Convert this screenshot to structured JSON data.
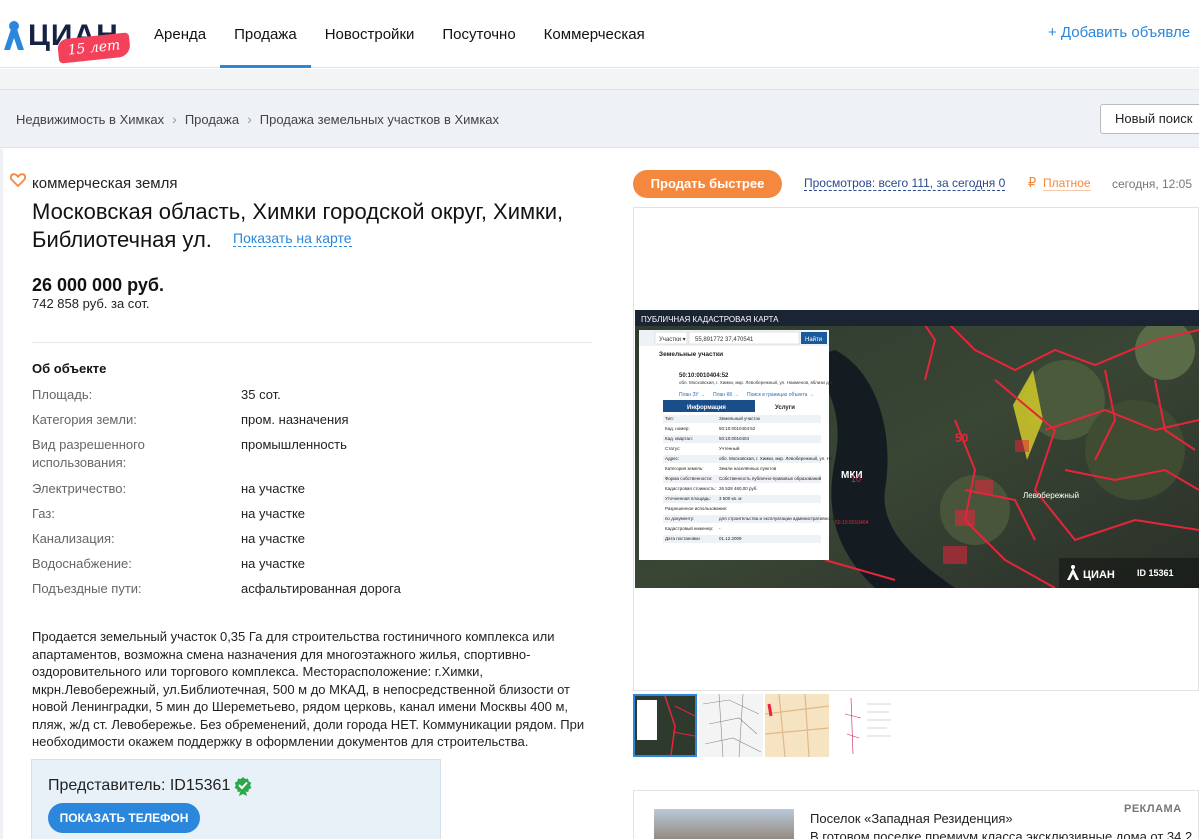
{
  "header": {
    "logo_text": "ЦИАН",
    "logo_badge": "15 лет",
    "nav": [
      {
        "label": "Аренда",
        "active": false
      },
      {
        "label": "Продажа",
        "active": true
      },
      {
        "label": "Новостройки",
        "active": false
      },
      {
        "label": "Посуточно",
        "active": false
      },
      {
        "label": "Коммерческая",
        "active": false
      }
    ],
    "add_ad": "+ Добавить объявле"
  },
  "breadcrumbs": {
    "items": [
      "Недвижимость в Химках",
      "Продажа",
      "Продажа земельных участков в Химках"
    ],
    "new_search": "Новый поиск"
  },
  "listing": {
    "category": "коммерческая земля",
    "address": "Московская область, Химки городской округ, Химки, Библиотечная ул.",
    "map_link": "Показать на карте",
    "price": "26 000 000 руб.",
    "price_per": "742 858 руб. за сот.",
    "about_title": "Об объекте",
    "props": [
      {
        "k": "Площадь:",
        "v": "35 сот."
      },
      {
        "k": "Категория земли:",
        "v": "пром. назначения"
      },
      {
        "k": "Вид разрешенного использования:",
        "v": "промышленность"
      },
      {
        "k": "Электричество:",
        "v": "на участке"
      },
      {
        "k": "Газ:",
        "v": "на участке"
      },
      {
        "k": "Канализация:",
        "v": "на участке"
      },
      {
        "k": "Водоснабжение:",
        "v": "на участке"
      },
      {
        "k": "Подъездные пути:",
        "v": "асфальтированная дорога"
      }
    ],
    "description": "Продается земельный участок 0,35 Га для строительства гостиничного комплекса или апартаментов, возможна смена назначения для многоэтажного жилья, спортивно-оздоровительного или торгового комплекса. Месторасположение: г.Химки, мкрн.Левобережный, ул.Библиотечная, 500 м до МКАД, в непосредственной близости от новой Ленинградки, 5 мин до Шереметьево, рядом церковь, канал имени Москвы 400 м, пляж, ж/д ст. Левобережье. Без обременений, доли города НЕТ. Коммуникации рядом. При необходимости окажем поддержку в оформлении документов для строительства.",
    "agent": "Представитель: ID15361",
    "phone_button": "ПОКАЗАТЬ ТЕЛЕФОН"
  },
  "sidebar": {
    "sell_button": "Продать быстрее",
    "views": "Просмотров: всего 111, за сегодня 0",
    "paid_icon": "₽",
    "paid": "Платное",
    "time": "сегодня, 12:05",
    "photo": {
      "map_title": "ПУБЛИЧНАЯ КАДАСТРОВАЯ КАРТА",
      "search_select": "Участки ▾",
      "search_value": "55,891772 37,470541",
      "search_button": "Найти",
      "panel_title": "Земельные участки",
      "parcel_no": "50:10:0010404:52",
      "parcel_addr": "обл. Московская, г. Химки, мкр. Левобережный, ул. Наименов, вблизи д.2",
      "links": [
        "План ЗУ →",
        "План КК →",
        "Поиск в границах объекта →"
      ],
      "tabs": [
        "Информация",
        "Услуги"
      ],
      "rows": [
        {
          "k": "Тип:",
          "v": "Земельный участок"
        },
        {
          "k": "Кад. номер:",
          "v": "50:10:0010404:52"
        },
        {
          "k": "Кад. квартал:",
          "v": "50:10:0010404"
        },
        {
          "k": "Статус:",
          "v": "Учтенный"
        },
        {
          "k": "Адрес:",
          "v": "обл. Московская, г. Химки, мкр. Левобережный, ул. Наименов, вблизи д.2"
        },
        {
          "k": "Категория земель:",
          "v": "Земли населённых пунктов"
        },
        {
          "k": "Форма собственности:",
          "v": "Собственность публично-правовых образований"
        },
        {
          "k": "Кадастровая стоимость:",
          "v": "26 528 460,00 руб."
        },
        {
          "k": "Уточненная площадь:",
          "v": "3 500 кв. м"
        },
        {
          "k": "Разрешенное использование:",
          "v": "-"
        },
        {
          "k": "по документу:",
          "v": "для строительства и эксплуатации административно-делового и гостиничного комплекса с автомобильной стоянкой"
        },
        {
          "k": "Кадастровый инженер:",
          "v": "-"
        },
        {
          "k": "Дата постановки",
          "v": "01.12.2009"
        }
      ],
      "map_labels": [
        "50",
        "МКИ",
        "10",
        "Левобережный",
        "50:10:0010404"
      ],
      "watermark": "ЦИАН",
      "watermark_id": "ID 15361"
    },
    "ad": {
      "label": "РЕКЛАМА",
      "title": "Поселок «Западная Резиденция»",
      "text": "В готовом поселке премиум класса эксклюзивные дома от 34,2"
    }
  },
  "colors": {
    "accent": "#2b87db",
    "orange": "#f4883f",
    "brand_red": "#f3415a",
    "cadastral_red": "#e8243a"
  }
}
